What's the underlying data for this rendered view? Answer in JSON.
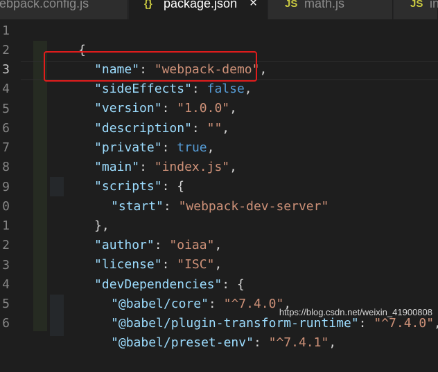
{
  "tabs": [
    {
      "icon": "",
      "label": "webpack.config.js",
      "active": false
    },
    {
      "icon": "{}",
      "label": "package.json",
      "active": true,
      "close": "×"
    },
    {
      "icon": "JS",
      "label": "math.js",
      "active": false
    },
    {
      "icon": "JS",
      "label": "in",
      "active": false
    }
  ],
  "line_numbers": [
    "1",
    "2",
    "3",
    "4",
    "5",
    "6",
    "7",
    "8",
    "9",
    "0",
    "1",
    "2",
    "3",
    "4",
    "5",
    "6"
  ],
  "code": {
    "l1": {
      "brace": "{"
    },
    "l2": {
      "key": "\"name\"",
      "sep": ": ",
      "val": "\"webpack-demo\"",
      "end": ","
    },
    "l3": {
      "key": "\"sideEffects\"",
      "sep": ": ",
      "val": "false",
      "end": ","
    },
    "l4": {
      "key": "\"version\"",
      "sep": ": ",
      "val": "\"1.0.0\"",
      "end": ","
    },
    "l5": {
      "key": "\"description\"",
      "sep": ": ",
      "val": "\"\"",
      "end": ","
    },
    "l6": {
      "key": "\"private\"",
      "sep": ": ",
      "val": "true",
      "end": ","
    },
    "l7": {
      "key": "\"main\"",
      "sep": ": ",
      "val": "\"index.js\"",
      "end": ","
    },
    "l8": {
      "key": "\"scripts\"",
      "sep": ": ",
      "val": "{"
    },
    "l9": {
      "key": "\"start\"",
      "sep": ": ",
      "val": "\"webpack-dev-server\""
    },
    "l10": {
      "brace": "},"
    },
    "l11": {
      "key": "\"author\"",
      "sep": ": ",
      "val": "\"oiaa\"",
      "end": ","
    },
    "l12": {
      "key": "\"license\"",
      "sep": ": ",
      "val": "\"ISC\"",
      "end": ","
    },
    "l13": {
      "key": "\"devDependencies\"",
      "sep": ": ",
      "val": "{"
    },
    "l14": {
      "key": "\"@babel/core\"",
      "sep": ": ",
      "val": "\"^7.4.0\"",
      "end": ","
    },
    "l15": {
      "key": "\"@babel/plugin-transform-runtime\"",
      "sep": ": ",
      "val": "\"^7.4.0\"",
      "end": ","
    },
    "l16": {
      "key": "\"@babel/preset-env\"",
      "sep": ": ",
      "val": "\"^7.4.1\"",
      "end": ","
    }
  },
  "watermark": "https://blog.csdn.net/weixin_41900808",
  "colors": {
    "background": "#1e1e1e",
    "key": "#9cdcfe",
    "string": "#ce9178",
    "keyword": "#569cd6",
    "highlight_box": "#e21c1c"
  }
}
